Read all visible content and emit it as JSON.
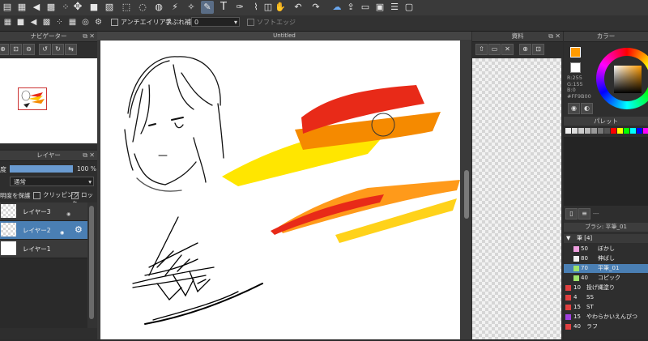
{
  "toolbar": {
    "icons": [
      "layers-icon",
      "grid-icon",
      "left-icon",
      "pattern-icon",
      "dots-icon",
      "square-icon",
      "hatch-icon",
      "lasso-icon",
      "dotted-lasso-icon",
      "wand-icon",
      "wand-select-icon",
      "brush-icon",
      "fill-icon",
      "text-icon",
      "gradient-icon",
      "eyedropper-icon",
      "eraser-icon",
      "hand-icon",
      "undo-icon",
      "redo-icon",
      "cloud-icon",
      "share-icon",
      "comment-icon",
      "document-icon",
      "notes-icon",
      "window-icon"
    ]
  },
  "options": {
    "antialias": "アンチエイリアス",
    "stabilizer": "手ぶれ補正",
    "stabilizer_value": "0",
    "soft_edge": "ソフトエッジ"
  },
  "navigator": {
    "title": "ナビゲーター"
  },
  "layers_panel": {
    "title": "レイヤー",
    "opacity_label": "度",
    "opacity_value": "100 %",
    "blend_mode": "通常",
    "protect_alpha": "明度を保護",
    "clipping": "クリッピング",
    "lock": "ロック",
    "layers": [
      {
        "name": "レイヤー3"
      },
      {
        "name": "レイヤー2"
      },
      {
        "name": "レイヤー1"
      }
    ]
  },
  "canvas": {
    "tab_title": "Untitled"
  },
  "materials": {
    "title": "資料"
  },
  "color_panel": {
    "title": "カラー",
    "r": "R:255",
    "g": "G:155",
    "b": "B:0",
    "hex": "#FF9B00",
    "current_color": "#ff9b00",
    "palette_title": "パレット"
  },
  "brush_panel": {
    "title": "ブラシ: 平筆_01",
    "group": "筆 [4]",
    "separator": "---",
    "brushes": [
      {
        "size": "50",
        "name": "ぼかし",
        "color": "#f0a0e0"
      },
      {
        "size": "80",
        "name": "伸ばし",
        "color": "#f0f0f0"
      },
      {
        "size": "70",
        "name": "平筆_01",
        "color": "#9de36a"
      },
      {
        "size": "40",
        "name": "コピック",
        "color": "#9de36a"
      },
      {
        "size": "10",
        "name": "投げ縄塗り",
        "color": "#e04040"
      },
      {
        "size": "4",
        "name": "SS",
        "color": "#e04040"
      },
      {
        "size": "15",
        "name": "ST",
        "color": "#e04040"
      },
      {
        "size": "15",
        "name": "やわらかいえんぴつ",
        "color": "#e04040"
      },
      {
        "size": "40",
        "name": "ラフ",
        "color": "#e04040"
      }
    ]
  }
}
